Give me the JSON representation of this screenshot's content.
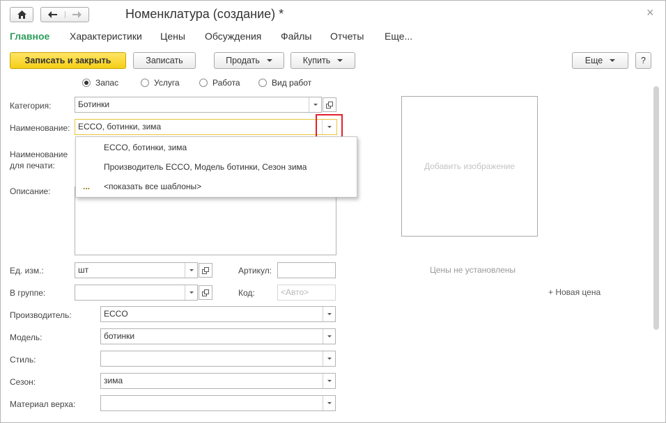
{
  "window": {
    "title": "Номенклатура (создание) *",
    "close_glyph": "×"
  },
  "toolbar_nav": {
    "home_icon": "home-icon",
    "back_icon": "arrow-left-icon",
    "forward_icon": "arrow-right-icon"
  },
  "tabs": [
    {
      "label": "Главное",
      "active": true
    },
    {
      "label": "Характеристики"
    },
    {
      "label": "Цены"
    },
    {
      "label": "Обсуждения"
    },
    {
      "label": "Файлы"
    },
    {
      "label": "Отчеты"
    },
    {
      "label": "Еще..."
    }
  ],
  "actions": {
    "save_close": "Записать и закрыть",
    "save": "Записать",
    "sell": "Продать",
    "buy": "Купить",
    "more": "Еще",
    "help": "?"
  },
  "type_radio": {
    "options": [
      "Запас",
      "Услуга",
      "Работа",
      "Вид работ"
    ],
    "selected": "Запас"
  },
  "form": {
    "category_label": "Категория:",
    "category_value": "Ботинки",
    "name_label": "Наименование:",
    "name_value": "ECCO, ботинки, зима",
    "print_name_label_1": "Наименование",
    "print_name_label_2": "для печати:",
    "description_label": "Описание:",
    "unit_label": "Ед. изм.:",
    "unit_value": "шт",
    "article_label": "Артикул:",
    "article_value": "",
    "group_label": "В группе:",
    "group_value": "",
    "code_label": "Код:",
    "code_placeholder": "<Авто>",
    "manufacturer_label": "Производитель:",
    "manufacturer_value": "ECCO",
    "model_label": "Модель:",
    "model_value": "ботинки",
    "style_label": "Стиль:",
    "style_value": "",
    "season_label": "Сезон:",
    "season_value": "зима",
    "upper_material_label": "Материал верха:",
    "upper_material_value": ""
  },
  "name_dropdown": {
    "items": [
      "ECCO, ботинки, зима",
      "Производитель ECCO, Модель ботинки, Сезон зима"
    ],
    "show_all_prefix": "...",
    "show_all": "<показать все шаблоны>"
  },
  "image": {
    "placeholder": "Добавить изображение"
  },
  "prices": {
    "status": "Цены не установлены",
    "new_price": "+ Новая цена"
  },
  "colors": {
    "accent_tab": "#2e9e5b",
    "primary_button": "#f5ce16",
    "focus_border": "#e8c53a",
    "highlight_box": "#e2202b"
  }
}
